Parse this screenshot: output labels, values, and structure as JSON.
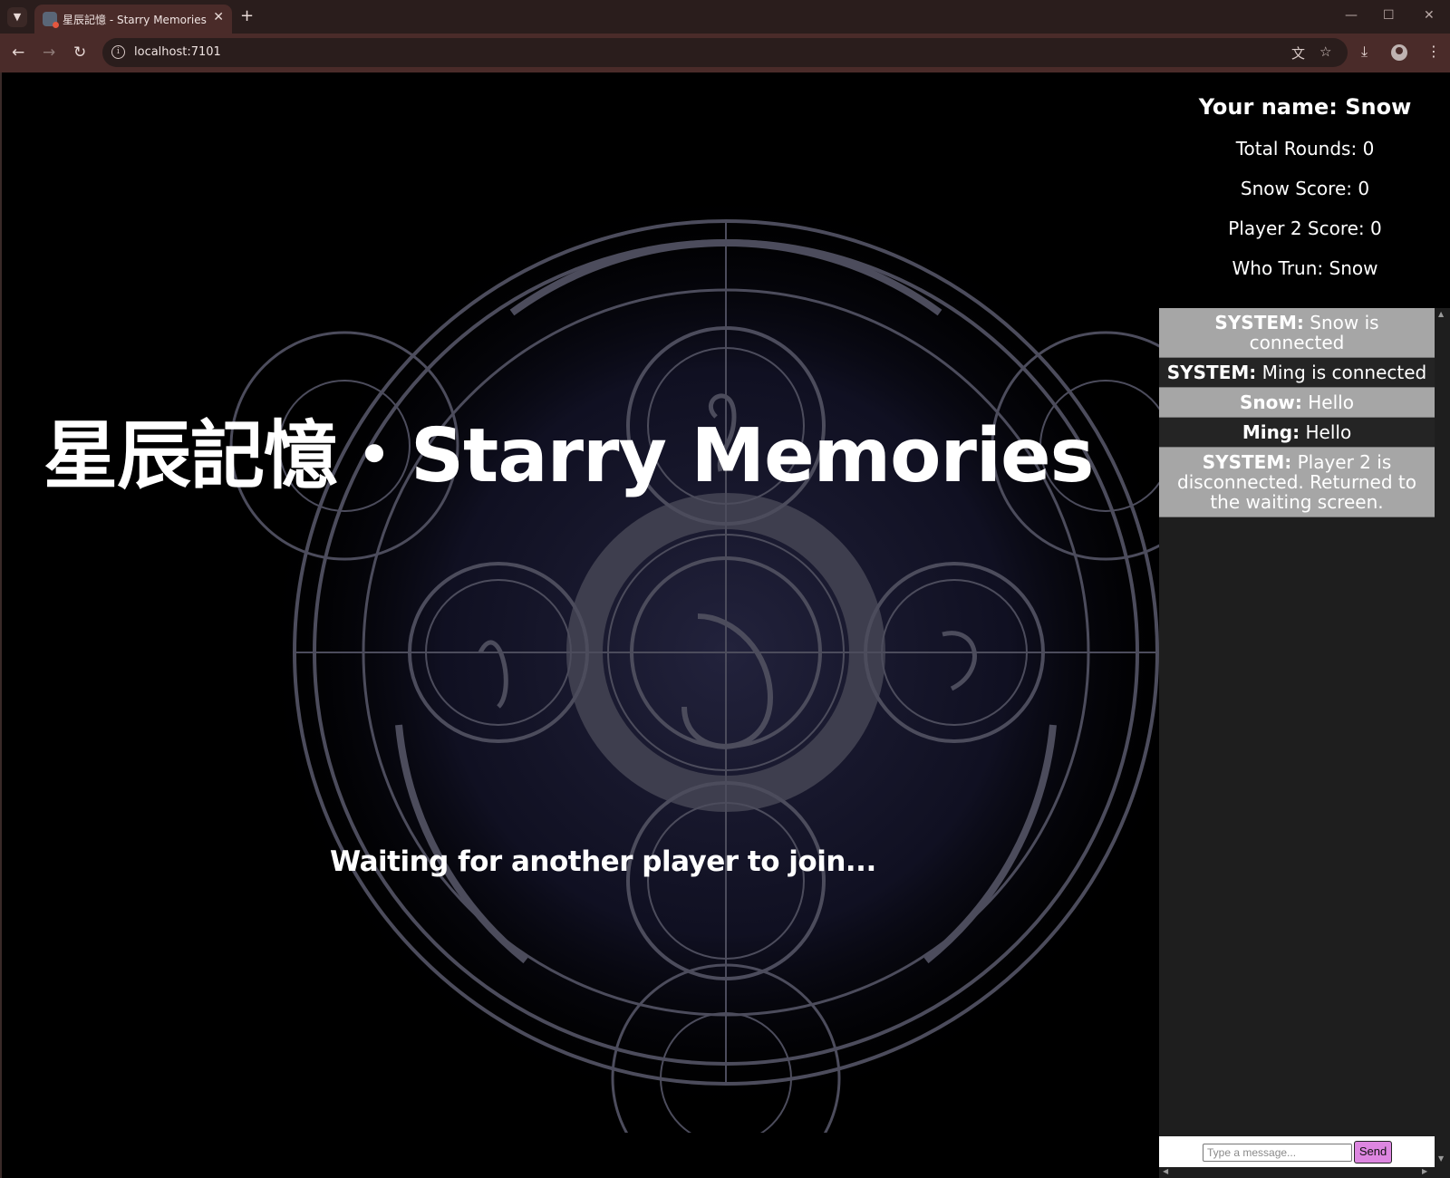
{
  "browser": {
    "tab_title": "星辰記憶 - Starry Memories",
    "url": "localhost:7101",
    "tab_list_icon": "chevron-down-icon",
    "new_tab_icon": "plus-icon"
  },
  "page": {
    "title": "星辰記憶・Starry Memories",
    "status_text": "Waiting for another player to join..."
  },
  "stats": {
    "your_name": "Your name: Snow",
    "total_rounds": "Total Rounds: 0",
    "snow_score": "Snow Score: 0",
    "player2_score": "Player 2 Score: 0",
    "who_turn": "Who Trun: Snow"
  },
  "chat": {
    "messages": [
      {
        "sender": "SYSTEM:",
        "text": " Snow is connected",
        "style": "light"
      },
      {
        "sender": "SYSTEM:",
        "text": " Ming is connected",
        "style": "dark"
      },
      {
        "sender": "Snow:",
        "text": " Hello",
        "style": "light"
      },
      {
        "sender": "Ming:",
        "text": " Hello",
        "style": "dark"
      },
      {
        "sender": "SYSTEM:",
        "text": " Player 2 is disconnected. Returned to the waiting screen.",
        "style": "light"
      }
    ],
    "input_placeholder": "Type a message...",
    "send_label": "Send"
  },
  "colors": {
    "chat_light": "#a6a6a6",
    "chat_dark": "#242424",
    "send_button": "#dd86e0",
    "browser_frame": "#4a2b29"
  }
}
